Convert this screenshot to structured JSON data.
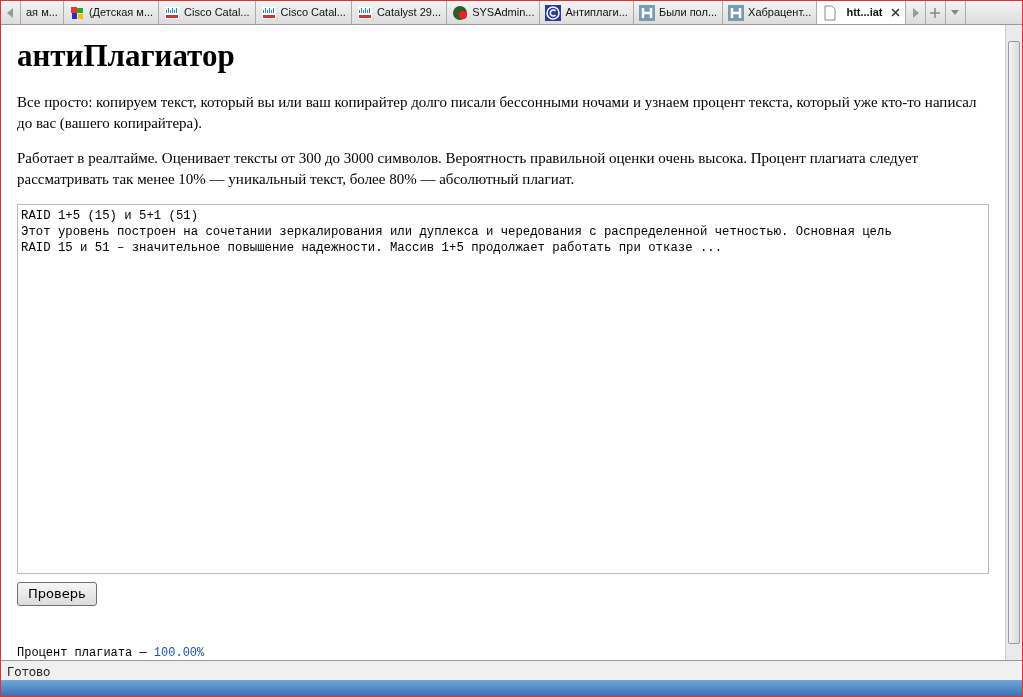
{
  "tabs": [
    {
      "label": "ая м...",
      "kind": "none",
      "selected": false
    },
    {
      "label": "(Детская м...",
      "kind": "colorful",
      "selected": false
    },
    {
      "label": "Cisco Catal...",
      "kind": "cisco",
      "selected": false
    },
    {
      "label": "Cisco Catal...",
      "kind": "cisco",
      "selected": false
    },
    {
      "label": "Catalyst 29...",
      "kind": "cisco",
      "selected": false
    },
    {
      "label": "SYSAdmin...",
      "kind": "round",
      "selected": false
    },
    {
      "label": "Антиплаги...",
      "kind": "copyright",
      "selected": false
    },
    {
      "label": "Были пол...",
      "kind": "letter",
      "selected": false
    },
    {
      "label": "Хабрацент...",
      "kind": "letter",
      "selected": false
    },
    {
      "label": "htt...iat",
      "kind": "page",
      "selected": true
    }
  ],
  "page": {
    "title": "антиПлагиатор",
    "paragraphs": [
      "Все просто: копируем текст, который вы или ваш копирайтер долго писали бессонными ночами и узнаем процент текста, который уже кто-то написал до вас (вашего копирайтера).",
      "Работает в реалтайме. Оценивает тексты от 300 до 3000 символов. Вероятность правильной оценки очень высока. Процент плагиата следует рассматривать так менее 10% — уникальный текст, более 80% — абсолютный плагиат."
    ],
    "text_lines": [
      "RAID 1+5 (15) и 5+1 (51)",
      "Этот уровень построен на сочетании зеркалирования или дуплекса и чередования с распределенной четностью. Основная цель",
      "RAID 15 и 51 – значительное повышение надежности. Массив 1+5 продолжает работать при отказе ..."
    ],
    "button": "Проверь",
    "result_label": "Процент плагиата —",
    "result_value": "100.00%"
  },
  "status_bar": "Готово"
}
